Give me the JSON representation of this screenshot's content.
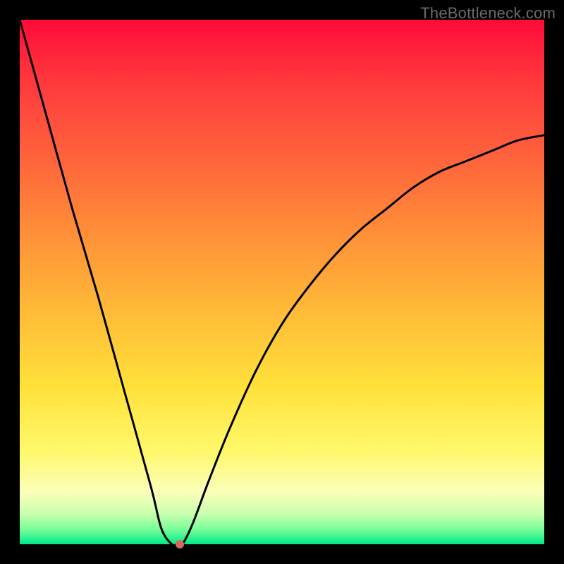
{
  "watermark": "TheBottleneck.com",
  "chart_data": {
    "type": "line",
    "title": "",
    "xlabel": "",
    "ylabel": "",
    "xlim": [
      0,
      100
    ],
    "ylim": [
      0,
      100
    ],
    "grid": false,
    "legend": false,
    "series": [
      {
        "name": "curve",
        "x": [
          0,
          5,
          10,
          15,
          20,
          25,
          27,
          29,
          30,
          31,
          33,
          36,
          40,
          45,
          50,
          55,
          60,
          65,
          70,
          75,
          80,
          85,
          90,
          95,
          100
        ],
        "values": [
          100,
          82,
          64,
          47,
          29,
          11,
          3,
          0,
          0,
          0,
          4,
          12,
          22,
          33,
          42,
          49,
          55,
          60,
          64,
          68,
          71,
          73,
          75,
          77,
          78
        ]
      }
    ],
    "marker": {
      "x": 30.5,
      "y": 0
    },
    "colors": {
      "line": "#000000",
      "marker": "#d46a5e"
    }
  }
}
